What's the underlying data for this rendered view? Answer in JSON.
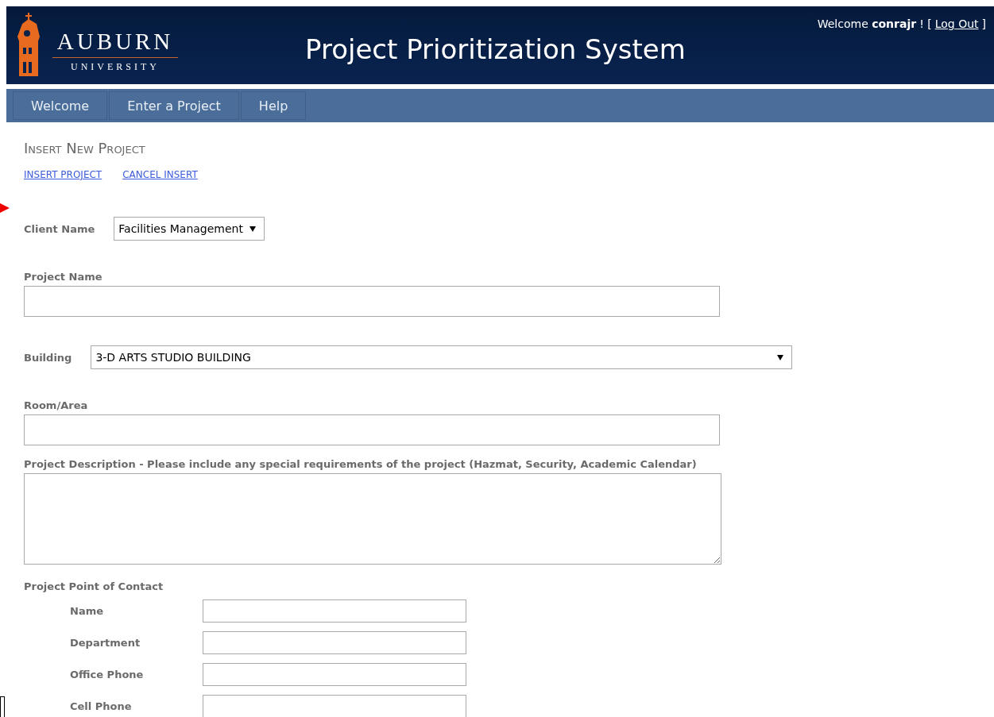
{
  "header": {
    "logo_word": "AUBURN",
    "logo_subword": "UNIVERSITY",
    "title": "Project Prioritization System",
    "welcome": "Welcome",
    "user": "conrajr",
    "punct_open": "! [",
    "logout": "Log Out",
    "punct_close": "]"
  },
  "nav": [
    {
      "label": "Welcome"
    },
    {
      "label": "Enter a Project"
    },
    {
      "label": "Help"
    }
  ],
  "page_title": "Insert New Project",
  "actions": [
    {
      "label": "INSERT PROJECT"
    },
    {
      "label": "CANCEL INSERT"
    }
  ],
  "form": {
    "client": {
      "label": "Client Name",
      "value": "Facilities Management"
    },
    "project_name": {
      "label": "Project Name"
    },
    "building": {
      "label": "Building",
      "value": "3-D ARTS STUDIO BUILDING"
    },
    "room": {
      "label": "Room/Area"
    },
    "description": {
      "label": "Project Description - Please include any special requirements of the project (Hazmat, Security, Academic Calendar)"
    },
    "contact": {
      "label": "Project Point of Contact",
      "fields": [
        {
          "label": "Name"
        },
        {
          "label": "Department"
        },
        {
          "label": "Office Phone"
        },
        {
          "label": "Cell Phone"
        }
      ]
    }
  }
}
